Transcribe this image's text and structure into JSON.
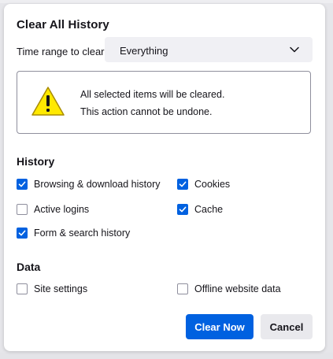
{
  "dialog": {
    "title": "Clear All History",
    "time_range": {
      "label": "Time range to clear:",
      "value": "Everything"
    },
    "warning": {
      "line1": "All selected items will be cleared.",
      "line2": "This action cannot be undone."
    },
    "history": {
      "heading": "History",
      "items": [
        {
          "label": "Browsing & download history",
          "checked": true
        },
        {
          "label": "Cookies",
          "checked": true
        },
        {
          "label": "Active logins",
          "checked": false
        },
        {
          "label": "Cache",
          "checked": true
        },
        {
          "label": "Form & search history",
          "checked": true
        }
      ]
    },
    "data": {
      "heading": "Data",
      "items": [
        {
          "label": "Site settings",
          "checked": false
        },
        {
          "label": "Offline website data",
          "checked": false
        }
      ]
    },
    "buttons": {
      "clear_now": "Clear Now",
      "cancel": "Cancel"
    }
  },
  "icons": {
    "warning": "warning-triangle-icon",
    "chevron": "chevron-down-icon",
    "check": "checkmark-icon"
  },
  "colors": {
    "accent": "#0061e0",
    "warning_fill": "#ffe900",
    "warning_stroke": "#a88b00"
  }
}
